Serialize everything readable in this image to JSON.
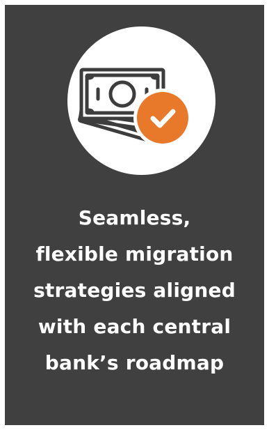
{
  "card": {
    "background": "#404040",
    "icon": {
      "name": "money-bills-check-icon",
      "line_color": "#3d3d3d",
      "badge_color": "#e8782a",
      "badge_glyph": "check-icon"
    },
    "headline_lines": [
      "Seamless,",
      "flexible migration",
      "strategies aligned",
      "with each central",
      "bank’s roadmap"
    ]
  }
}
